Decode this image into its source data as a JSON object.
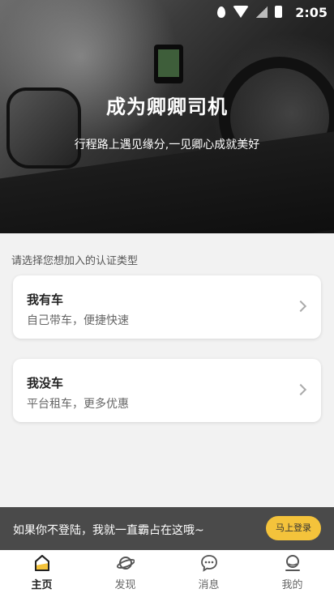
{
  "status": {
    "time": "2:05"
  },
  "hero": {
    "title": "成为卿卿司机",
    "subtitle": "行程路上遇见缘分,一见卿心成就美好"
  },
  "hint": "请选择您想加入的认证类型",
  "cards": [
    {
      "title": "我有车",
      "desc": "自己带车，便捷快速"
    },
    {
      "title": "我没车",
      "desc": "平台租车，更多优惠"
    }
  ],
  "login_bar": {
    "message": "如果你不登陆，我就一直霸占在这哦~",
    "button": "马上登录"
  },
  "tabs": [
    {
      "label": "主页",
      "icon": "home-icon",
      "active": true
    },
    {
      "label": "发现",
      "icon": "planet-icon",
      "active": false
    },
    {
      "label": "消息",
      "icon": "chat-icon",
      "active": false
    },
    {
      "label": "我的",
      "icon": "profile-icon",
      "active": false
    }
  ],
  "colors": {
    "accent": "#f4c33b"
  }
}
